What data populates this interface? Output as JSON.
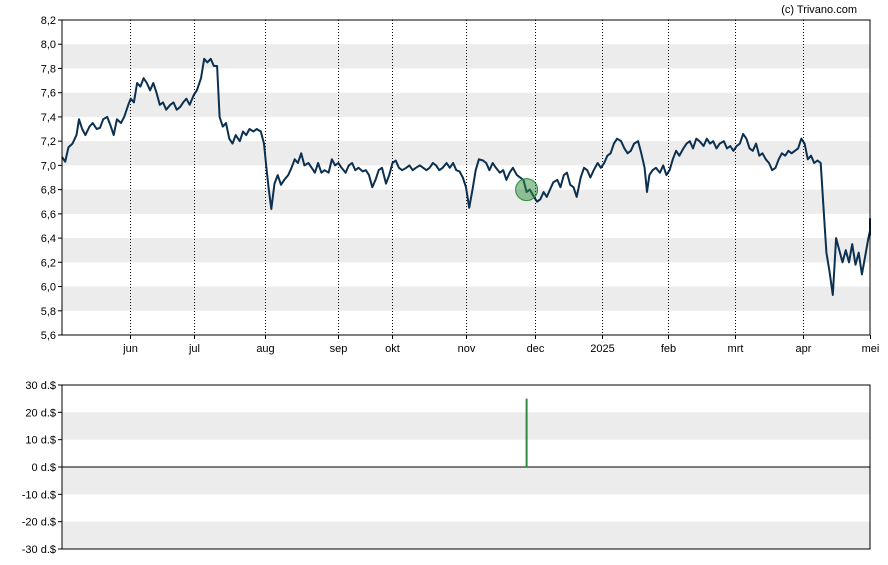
{
  "copyright": "(c) Trivano.com",
  "chart_data": [
    {
      "type": "line",
      "ylim": [
        5.6,
        8.2
      ],
      "yticks": [
        "8,2",
        "8,0",
        "7,8",
        "7,6",
        "7,4",
        "7,2",
        "7,0",
        "6,8",
        "6,6",
        "6,4",
        "6,2",
        "6,0",
        "5,8",
        "5,6"
      ],
      "ytick_values": [
        8.2,
        8.0,
        7.8,
        7.6,
        7.4,
        7.2,
        7.0,
        6.8,
        6.6,
        6.4,
        6.2,
        6.0,
        5.8,
        5.6
      ],
      "xlim": [
        0,
        100
      ],
      "xticks": [
        {
          "label": "jun",
          "pos": 8.4
        },
        {
          "label": "jul",
          "pos": 16.3
        },
        {
          "label": "aug",
          "pos": 25.1
        },
        {
          "label": "sep",
          "pos": 34.1
        },
        {
          "label": "okt",
          "pos": 40.9
        },
        {
          "label": "nov",
          "pos": 50.0
        },
        {
          "label": "dec",
          "pos": 58.5
        },
        {
          "label": "2025",
          "pos": 66.8
        },
        {
          "label": "feb",
          "pos": 75.0
        },
        {
          "label": "mrt",
          "pos": 83.3
        },
        {
          "label": "apr",
          "pos": 91.7
        },
        {
          "label": "mei",
          "pos": 100
        }
      ],
      "grid": "horizontal bands + dotted month lines",
      "series": [
        {
          "color": "#0b3050",
          "points": [
            [
              0,
              7.07
            ],
            [
              0.4,
              7.03
            ],
            [
              0.8,
              7.15
            ],
            [
              1.3,
              7.18
            ],
            [
              1.8,
              7.25
            ],
            [
              2.1,
              7.38
            ],
            [
              2.5,
              7.3
            ],
            [
              2.9,
              7.25
            ],
            [
              3.4,
              7.32
            ],
            [
              3.8,
              7.35
            ],
            [
              4.3,
              7.3
            ],
            [
              4.7,
              7.31
            ],
            [
              5.1,
              7.38
            ],
            [
              5.6,
              7.4
            ],
            [
              6.0,
              7.33
            ],
            [
              6.4,
              7.25
            ],
            [
              6.8,
              7.38
            ],
            [
              7.3,
              7.35
            ],
            [
              7.7,
              7.4
            ],
            [
              8.2,
              7.5
            ],
            [
              8.5,
              7.55
            ],
            [
              8.9,
              7.52
            ],
            [
              9.3,
              7.68
            ],
            [
              9.7,
              7.65
            ],
            [
              10.1,
              7.72
            ],
            [
              10.5,
              7.68
            ],
            [
              10.9,
              7.62
            ],
            [
              11.3,
              7.68
            ],
            [
              11.7,
              7.6
            ],
            [
              12.1,
              7.5
            ],
            [
              12.5,
              7.52
            ],
            [
              12.9,
              7.46
            ],
            [
              13.4,
              7.5
            ],
            [
              13.8,
              7.52
            ],
            [
              14.2,
              7.46
            ],
            [
              14.6,
              7.48
            ],
            [
              15.0,
              7.52
            ],
            [
              15.4,
              7.55
            ],
            [
              15.8,
              7.5
            ],
            [
              16.3,
              7.58
            ],
            [
              16.7,
              7.62
            ],
            [
              17.2,
              7.72
            ],
            [
              17.6,
              7.88
            ],
            [
              18.0,
              7.85
            ],
            [
              18.4,
              7.88
            ],
            [
              18.8,
              7.82
            ],
            [
              19.2,
              7.82
            ],
            [
              19.5,
              7.4
            ],
            [
              19.9,
              7.32
            ],
            [
              20.3,
              7.35
            ],
            [
              20.7,
              7.22
            ],
            [
              21.1,
              7.18
            ],
            [
              21.5,
              7.25
            ],
            [
              22.0,
              7.2
            ],
            [
              22.4,
              7.28
            ],
            [
              22.8,
              7.25
            ],
            [
              23.2,
              7.3
            ],
            [
              23.7,
              7.28
            ],
            [
              24.1,
              7.3
            ],
            [
              24.6,
              7.28
            ],
            [
              25.0,
              7.18
            ],
            [
              25.3,
              6.98
            ],
            [
              25.6,
              6.8
            ],
            [
              25.9,
              6.64
            ],
            [
              26.3,
              6.85
            ],
            [
              26.7,
              6.92
            ],
            [
              27.1,
              6.84
            ],
            [
              27.5,
              6.88
            ],
            [
              28.0,
              6.92
            ],
            [
              28.4,
              6.98
            ],
            [
              28.8,
              7.05
            ],
            [
              29.2,
              7.02
            ],
            [
              29.6,
              7.1
            ],
            [
              30.0,
              7.0
            ],
            [
              30.5,
              7.02
            ],
            [
              30.9,
              6.98
            ],
            [
              31.3,
              6.94
            ],
            [
              31.7,
              7.02
            ],
            [
              32.1,
              6.94
            ],
            [
              32.5,
              6.96
            ],
            [
              33.0,
              6.94
            ],
            [
              33.4,
              7.05
            ],
            [
              33.8,
              7.0
            ],
            [
              34.2,
              7.02
            ],
            [
              34.6,
              6.98
            ],
            [
              35.1,
              6.94
            ],
            [
              35.5,
              7.0
            ],
            [
              35.9,
              7.02
            ],
            [
              36.3,
              6.96
            ],
            [
              36.7,
              6.98
            ],
            [
              37.2,
              6.95
            ],
            [
              37.6,
              6.96
            ],
            [
              38.0,
              6.92
            ],
            [
              38.4,
              6.82
            ],
            [
              38.8,
              6.88
            ],
            [
              39.2,
              6.96
            ],
            [
              39.6,
              6.98
            ],
            [
              40.1,
              6.85
            ],
            [
              40.5,
              6.92
            ],
            [
              40.9,
              7.02
            ],
            [
              41.3,
              7.04
            ],
            [
              41.7,
              6.98
            ],
            [
              42.1,
              6.96
            ],
            [
              42.6,
              6.98
            ],
            [
              43.0,
              7.0
            ],
            [
              43.4,
              6.96
            ],
            [
              43.8,
              6.98
            ],
            [
              44.3,
              7.0
            ],
            [
              44.7,
              6.98
            ],
            [
              45.1,
              6.96
            ],
            [
              45.5,
              6.98
            ],
            [
              45.9,
              7.02
            ],
            [
              46.3,
              7.0
            ],
            [
              46.7,
              6.96
            ],
            [
              47.1,
              6.98
            ],
            [
              47.6,
              7.02
            ],
            [
              48.0,
              6.98
            ],
            [
              48.4,
              7.02
            ],
            [
              48.8,
              6.96
            ],
            [
              49.2,
              6.95
            ],
            [
              49.6,
              6.9
            ],
            [
              50.0,
              6.82
            ],
            [
              50.4,
              6.65
            ],
            [
              50.8,
              6.8
            ],
            [
              51.2,
              6.96
            ],
            [
              51.6,
              7.05
            ],
            [
              52.1,
              7.04
            ],
            [
              52.5,
              7.02
            ],
            [
              52.9,
              6.96
            ],
            [
              53.3,
              7.02
            ],
            [
              53.7,
              6.98
            ],
            [
              54.2,
              6.94
            ],
            [
              54.6,
              6.96
            ],
            [
              55.0,
              6.88
            ],
            [
              55.4,
              6.94
            ],
            [
              55.8,
              6.98
            ],
            [
              56.3,
              6.92
            ],
            [
              56.7,
              6.9
            ],
            [
              57.1,
              6.88
            ],
            [
              57.5,
              6.78
            ],
            [
              57.9,
              6.8
            ],
            [
              58.4,
              6.74
            ],
            [
              58.8,
              6.7
            ],
            [
              59.2,
              6.72
            ],
            [
              59.6,
              6.78
            ],
            [
              60.0,
              6.74
            ],
            [
              60.4,
              6.8
            ],
            [
              60.8,
              6.86
            ],
            [
              61.3,
              6.88
            ],
            [
              61.7,
              6.82
            ],
            [
              62.1,
              6.92
            ],
            [
              62.5,
              6.94
            ],
            [
              62.9,
              6.84
            ],
            [
              63.3,
              6.82
            ],
            [
              63.7,
              6.74
            ],
            [
              64.2,
              6.9
            ],
            [
              64.6,
              6.98
            ],
            [
              65.0,
              6.96
            ],
            [
              65.4,
              6.9
            ],
            [
              65.8,
              6.96
            ],
            [
              66.3,
              7.02
            ],
            [
              66.7,
              6.98
            ],
            [
              67.1,
              7.02
            ],
            [
              67.5,
              7.08
            ],
            [
              67.9,
              7.1
            ],
            [
              68.3,
              7.18
            ],
            [
              68.7,
              7.22
            ],
            [
              69.2,
              7.2
            ],
            [
              69.6,
              7.14
            ],
            [
              70.0,
              7.1
            ],
            [
              70.4,
              7.12
            ],
            [
              70.8,
              7.18
            ],
            [
              71.3,
              7.2
            ],
            [
              71.7,
              7.1
            ],
            [
              72.1,
              6.98
            ],
            [
              72.4,
              6.78
            ],
            [
              72.7,
              6.92
            ],
            [
              73.1,
              6.96
            ],
            [
              73.5,
              6.98
            ],
            [
              74.0,
              6.94
            ],
            [
              74.4,
              7.0
            ],
            [
              74.8,
              6.92
            ],
            [
              75.2,
              6.96
            ],
            [
              75.6,
              7.05
            ],
            [
              76.0,
              7.12
            ],
            [
              76.4,
              7.08
            ],
            [
              76.9,
              7.14
            ],
            [
              77.3,
              7.18
            ],
            [
              77.7,
              7.2
            ],
            [
              78.1,
              7.14
            ],
            [
              78.5,
              7.22
            ],
            [
              78.9,
              7.2
            ],
            [
              79.4,
              7.16
            ],
            [
              79.8,
              7.22
            ],
            [
              80.2,
              7.18
            ],
            [
              80.6,
              7.2
            ],
            [
              81.0,
              7.14
            ],
            [
              81.4,
              7.18
            ],
            [
              81.9,
              7.2
            ],
            [
              82.3,
              7.14
            ],
            [
              82.7,
              7.16
            ],
            [
              83.1,
              7.12
            ],
            [
              83.5,
              7.16
            ],
            [
              83.9,
              7.18
            ],
            [
              84.3,
              7.26
            ],
            [
              84.7,
              7.22
            ],
            [
              85.1,
              7.14
            ],
            [
              85.5,
              7.12
            ],
            [
              85.9,
              7.18
            ],
            [
              86.3,
              7.08
            ],
            [
              86.7,
              7.1
            ],
            [
              87.1,
              7.05
            ],
            [
              87.5,
              7.02
            ],
            [
              87.9,
              6.96
            ],
            [
              88.3,
              6.98
            ],
            [
              88.7,
              7.05
            ],
            [
              89.1,
              7.1
            ],
            [
              89.5,
              7.08
            ],
            [
              89.9,
              7.12
            ],
            [
              90.3,
              7.1
            ],
            [
              90.7,
              7.12
            ],
            [
              91.1,
              7.14
            ],
            [
              91.5,
              7.22
            ],
            [
              91.9,
              7.18
            ],
            [
              92.3,
              7.05
            ],
            [
              92.7,
              7.08
            ],
            [
              93.1,
              7.02
            ],
            [
              93.5,
              7.04
            ],
            [
              93.9,
              7.02
            ],
            [
              94.3,
              6.6
            ],
            [
              94.6,
              6.28
            ],
            [
              95.0,
              6.12
            ],
            [
              95.4,
              5.93
            ],
            [
              95.8,
              6.4
            ],
            [
              96.2,
              6.3
            ],
            [
              96.6,
              6.2
            ],
            [
              97.0,
              6.3
            ],
            [
              97.4,
              6.2
            ],
            [
              97.8,
              6.35
            ],
            [
              98.2,
              6.18
            ],
            [
              98.6,
              6.28
            ],
            [
              99.0,
              6.1
            ],
            [
              99.4,
              6.25
            ],
            [
              99.8,
              6.4
            ],
            [
              100.2,
              6.46
            ],
            [
              100.6,
              6.56
            ],
            [
              101.0,
              6.52
            ],
            [
              101.4,
              6.42
            ]
          ]
        }
      ],
      "marker": {
        "x": 57.5,
        "y": 6.8,
        "color": "#2e8b3e"
      }
    },
    {
      "type": "bar",
      "ylim": [
        -30,
        30
      ],
      "yticks": [
        "30 d.$",
        "20 d.$",
        "10 d.$",
        "0 d.$",
        "-10 d.$",
        "-20 d.$",
        "-30 d.$"
      ],
      "ytick_values": [
        30,
        20,
        10,
        0,
        -10,
        -20,
        -30
      ],
      "xlim": [
        0,
        100
      ],
      "bars": [
        {
          "x": 57.5,
          "value": 25,
          "color": "#2e8b3e"
        }
      ]
    }
  ]
}
